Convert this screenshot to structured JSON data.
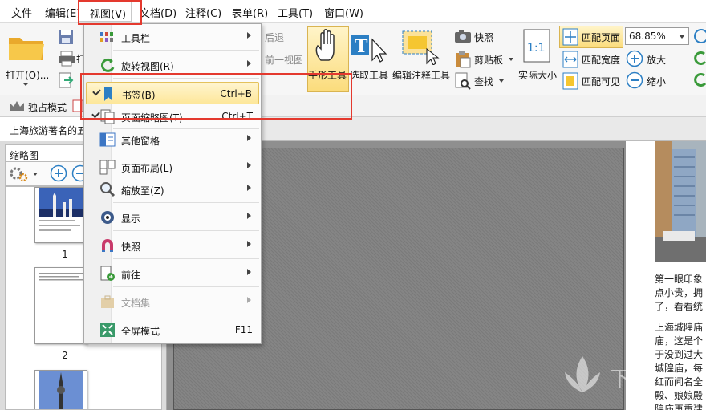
{
  "menubar": {
    "items": [
      "文件",
      "编辑(E)",
      "视图(V)",
      "文档(D)",
      "注释(C)",
      "表单(R)",
      "工具(T)",
      "窗口(W)"
    ]
  },
  "ribbon": {
    "open": "打开(O)...",
    "back": "后退",
    "prev_view": "前一视图",
    "hand_tool": "手形工具",
    "select_tool": "选取工具",
    "annot_tool": "编辑注释工具",
    "snapshot": "快照",
    "clipboard": "剪贴板",
    "find": "查找",
    "actual_size": "实际大小",
    "fit_page": "匹配页面",
    "fit_width": "匹配宽度",
    "fit_visible": "匹配可见",
    "zoom_value": "68.85%",
    "zoom_in": "放大",
    "zoom_out": "缩小"
  },
  "quickbar": {
    "exclusive_mode": "独占模式"
  },
  "doc_tab": {
    "title": "上海旅游著名的五"
  },
  "thumbnails": {
    "title": "缩略图",
    "pages": [
      "1",
      "2"
    ]
  },
  "right_page": {
    "para1": [
      "第一眼印象",
      "点小贵，拥",
      "了，看看统"
    ],
    "para2": [
      "上海城隍庙",
      "庙，这是个",
      "于没到过大",
      "城隍庙，每",
      "红而闻名全",
      "殿、娘娘殿",
      "隍庙再重建"
    ]
  },
  "watermark": "下载",
  "view_menu": {
    "items": [
      {
        "label": "工具栏",
        "shortcut": ""
      },
      {
        "label": "旋转视图(R)",
        "shortcut": ""
      },
      {
        "label": "书签(B)",
        "shortcut": "Ctrl+B"
      },
      {
        "label": "页面缩略图(T)",
        "shortcut": "Ctrl+T"
      },
      {
        "label": "其他窗格",
        "shortcut": ""
      },
      {
        "label": "页面布局(L)",
        "shortcut": ""
      },
      {
        "label": "缩放至(Z)",
        "shortcut": ""
      },
      {
        "label": "显示",
        "shortcut": ""
      },
      {
        "label": "快照",
        "shortcut": ""
      },
      {
        "label": "前往",
        "shortcut": ""
      },
      {
        "label": "文档集",
        "shortcut": ""
      },
      {
        "label": "全屏模式",
        "shortcut": "F11"
      }
    ]
  },
  "colors": {
    "highlight_red": "#e4392e",
    "menu_hover": "#fde79a"
  },
  "icons": [
    "folder-icon",
    "save-icon",
    "print-icon",
    "hand-icon",
    "select-text-icon",
    "annotation-icon",
    "camera-icon",
    "clipboard-icon",
    "find-icon",
    "actual-size-icon",
    "fit-page-icon",
    "fit-width-icon",
    "fit-visible-icon",
    "zoom-in-icon",
    "zoom-out-icon",
    "bookmark-icon",
    "toolbar-icon",
    "rotate-icon",
    "fullscreen-icon"
  ]
}
